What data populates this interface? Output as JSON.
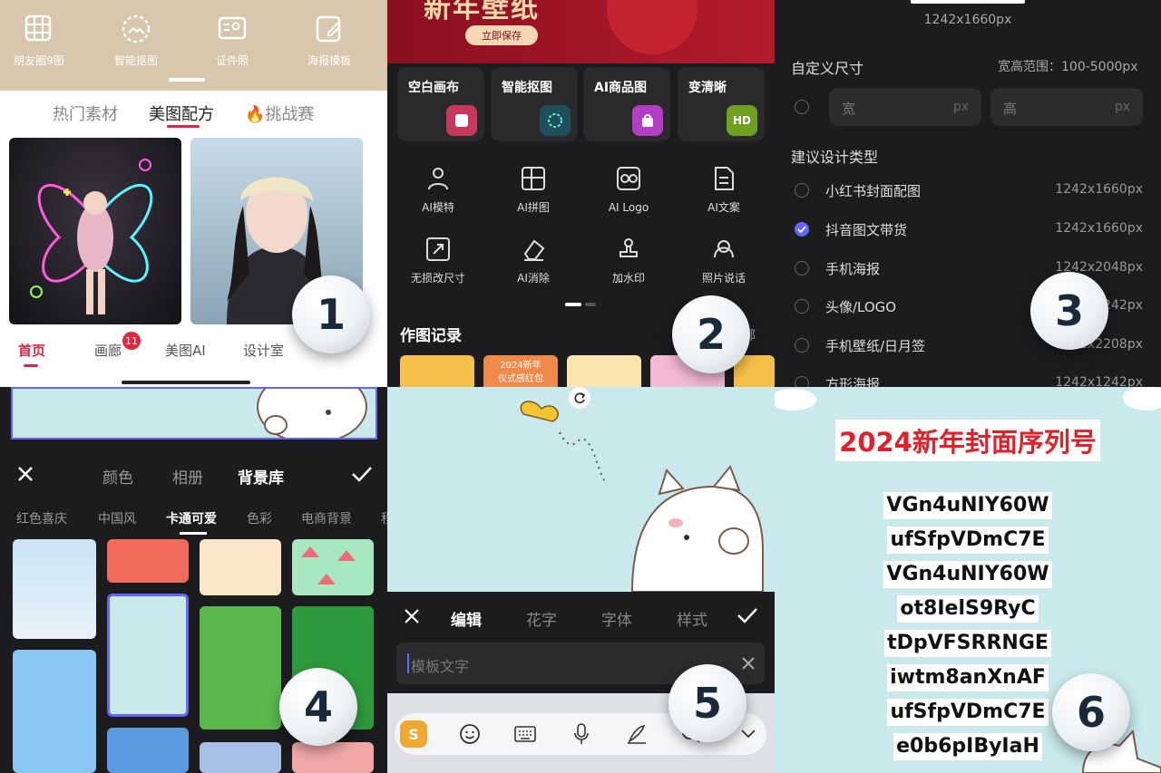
{
  "panel1": {
    "tools": [
      {
        "label": "朋友圈9图",
        "icon": "grid-9-icon"
      },
      {
        "label": "智能抠图",
        "icon": "cutout-icon"
      },
      {
        "label": "证件照",
        "icon": "id-photo-icon"
      },
      {
        "label": "海报模板",
        "icon": "poster-edit-icon"
      }
    ],
    "tabs": [
      "热门素材",
      "美图配方",
      "🔥挑战赛"
    ],
    "nav": [
      "首页",
      "画廊",
      "美图AI",
      "设计室"
    ],
    "nav_badge": "11",
    "number": "1"
  },
  "panel2": {
    "banner_title": "新年壁纸",
    "banner_button": "立即保存",
    "cards": [
      "空白画布",
      "智能抠图",
      "AI商品图",
      "变清晰"
    ],
    "hd_label": "HD",
    "tools": [
      {
        "label": "AI模特",
        "icon": "ai-model-icon"
      },
      {
        "label": "AI拼图",
        "icon": "ai-collage-icon"
      },
      {
        "label": "AI Logo",
        "icon": "ai-logo-icon"
      },
      {
        "label": "AI文案",
        "icon": "ai-copy-icon"
      },
      {
        "label": "无损改尺寸",
        "icon": "resize-icon"
      },
      {
        "label": "AI消除",
        "icon": "eraser-icon"
      },
      {
        "label": "加水印",
        "icon": "watermark-icon"
      },
      {
        "label": "照片说话",
        "icon": "photo-talk-icon"
      }
    ],
    "records_title": "作图记录",
    "records_more": "部",
    "thumb_text_1": "2024新年",
    "thumb_text_2": "仪式感红包",
    "number": "2"
  },
  "panel3": {
    "top_size": "1242x1660px",
    "custom_label": "自定义尺寸",
    "range_label": "宽高范围：100-5000px",
    "width_placeholder": "宽",
    "height_placeholder": "高",
    "unit": "px",
    "suggest_label": "建议设计类型",
    "types": [
      {
        "name": "小红书封面配图",
        "size": "1242x1660px",
        "selected": false
      },
      {
        "name": "抖音图文带货",
        "size": "1242x1660px",
        "selected": true
      },
      {
        "name": "手机海报",
        "size": "1242x2048px",
        "selected": false
      },
      {
        "name": "头像/LOGO",
        "size": "1242x1242px",
        "selected": false
      },
      {
        "name": "手机壁纸/日月签",
        "size": "1242x2208px",
        "selected": false
      },
      {
        "name": "方形海报",
        "size": "1242x1242px",
        "selected": false
      }
    ],
    "number": "3"
  },
  "panel4": {
    "header_tabs": [
      "颜色",
      "相册",
      "背景库"
    ],
    "categories": [
      "红色喜庆",
      "中国风",
      "卡通可爱",
      "色彩",
      "电商背景",
      "程"
    ],
    "active_category": "卡通可爱",
    "number": "4"
  },
  "panel5": {
    "tabs": [
      "编辑",
      "花字",
      "字体",
      "样式"
    ],
    "input_placeholder": "模板文字",
    "number": "5"
  },
  "panel6": {
    "title": "2024新年封面序列号",
    "codes": [
      "VGn4uNIY60W",
      "ufSfpVDmC7E",
      "VGn4uNIY60W",
      "ot8IelS9RyC",
      "tDpVFSRRNGE",
      "iwtm8anXnAF",
      "ufSfpVDmC7E",
      "e0b6pIByIaH"
    ],
    "number": "6"
  },
  "colors": {
    "accent_red": "#e1253f",
    "selected_blue": "#6464ff",
    "dark_bg": "#1c1c1e",
    "sky_bg": "#c9e9ec"
  }
}
